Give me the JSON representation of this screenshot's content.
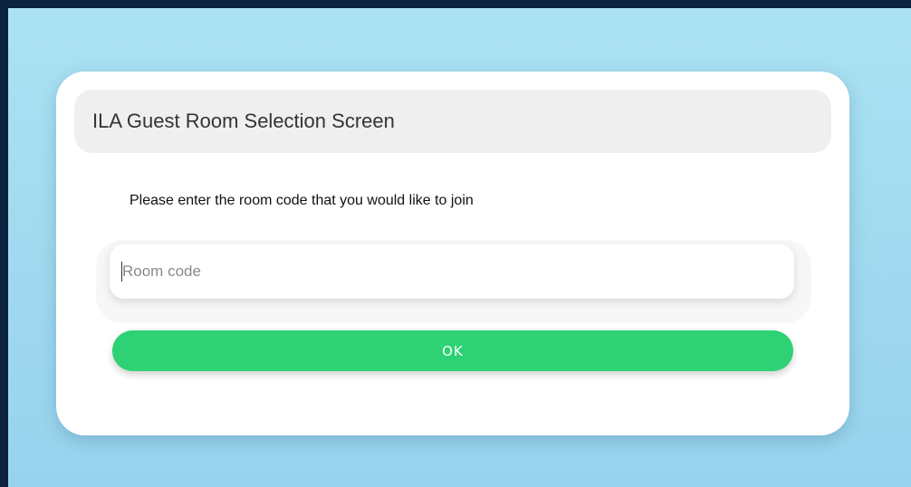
{
  "colors": {
    "frame_border": "#0c2340",
    "background": "#a5ddf1",
    "card": "#ffffff",
    "header_bg": "#efefef",
    "button": "#2ed174",
    "button_text": "#ffffff"
  },
  "card": {
    "title": "ILA Guest Room Selection Screen",
    "instruction": "Please enter the room code that you would like to join",
    "room_input": {
      "placeholder": "Room code",
      "value": ""
    },
    "ok_label": "OK"
  }
}
